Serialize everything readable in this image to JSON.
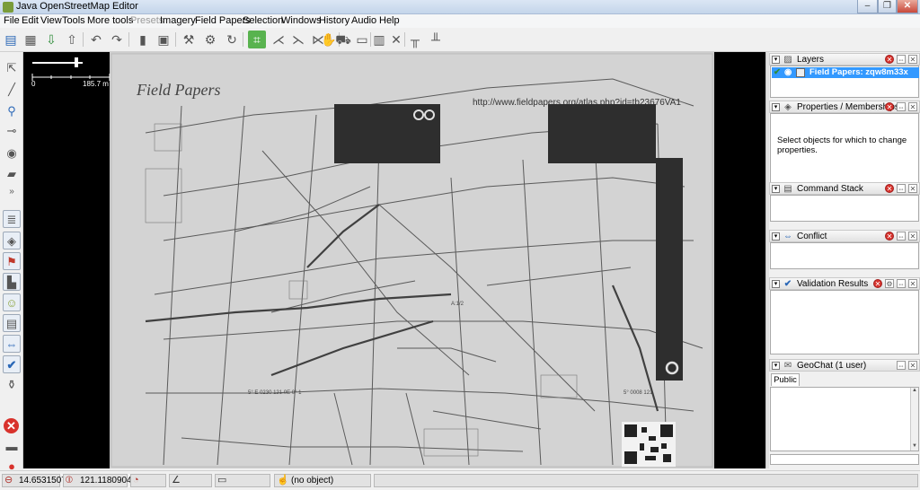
{
  "window": {
    "title": "Java OpenStreetMap Editor",
    "minimize_glyph": "–",
    "maximize_glyph": "❐",
    "close_glyph": "✕"
  },
  "menu": [
    {
      "label": "File",
      "enabled": true
    },
    {
      "label": "Edit",
      "enabled": true
    },
    {
      "label": "View",
      "enabled": true
    },
    {
      "label": "Tools",
      "enabled": true
    },
    {
      "label": "More tools",
      "enabled": true
    },
    {
      "label": "Presets",
      "enabled": false
    },
    {
      "label": "Imagery",
      "enabled": true
    },
    {
      "label": "Field Papers",
      "enabled": true
    },
    {
      "label": "Selection",
      "enabled": true
    },
    {
      "label": "Windows",
      "enabled": true
    },
    {
      "label": "History",
      "enabled": true
    },
    {
      "label": "Audio",
      "enabled": true
    },
    {
      "label": "Help",
      "enabled": true
    }
  ],
  "toolbar_icons": [
    "open-icon",
    "save-icon",
    "download-icon",
    "upload-icon",
    "undo-icon",
    "redo-icon",
    "copy-icon",
    "properties-icon",
    "preferences-icon",
    "filter-icon",
    "refresh-icon",
    "select-area-icon",
    "split-way-icon",
    "combine-icon",
    "align-icon",
    "hand-icon",
    "car-icon",
    "bus-icon",
    "delete-icon",
    "cross-icon",
    "poles-icon",
    "barrier-icon"
  ],
  "map": {
    "scale_start": "0",
    "scale_end": "185.7 m",
    "paper_heading": "Field Papers",
    "paper_url": "http://www.fieldpapers.org/atlas.php?id=tb23676VA1",
    "corner_label_1": "5° E 0230 121.0E 0° 1",
    "corner_label_2": "5° 0008 121",
    "corner_label_3": "A:1/2"
  },
  "panels": {
    "layers": {
      "title": "Layers",
      "layer_name": "Field Papers: zqw8m33x"
    },
    "properties": {
      "title": "Properties / Memberships",
      "message": "Select objects for which to change properties."
    },
    "command_stack": {
      "title": "Command Stack"
    },
    "conflict": {
      "title": "Conflict"
    },
    "validation": {
      "title": "Validation Results"
    },
    "geochat": {
      "title": "GeoChat (1 user)",
      "tab": "Public"
    }
  },
  "status": {
    "latitude": "14.6531507",
    "longitude": "121.1180904",
    "selection": "(no object)"
  }
}
